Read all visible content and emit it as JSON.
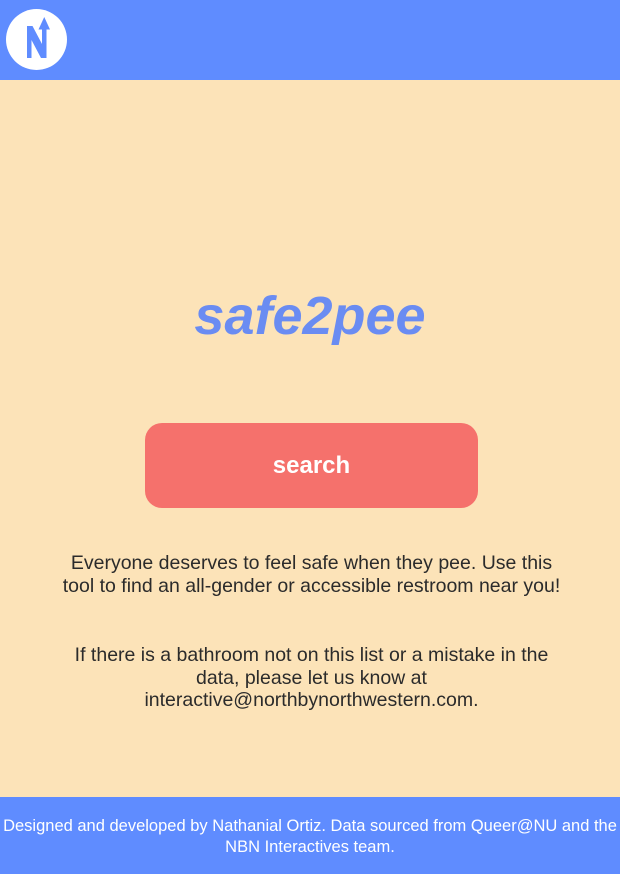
{
  "header": {
    "logo_icon": "nbn-compass-logo-icon",
    "logo_letter": "N",
    "background_color": "#5f8cff"
  },
  "main": {
    "title": "safe2pee",
    "title_color": "#6a8cf2",
    "search_button_label": "search",
    "search_button_color": "#f5716c",
    "description_1": "Everyone deserves to feel safe when they pee. Use this tool to find an all-gender or accessible restroom near you!",
    "description_2": "If there is a bathroom not on this list or a mistake in the data, please let us know at interactive@northbynorthwestern.com.",
    "background_color": "#fce3b8"
  },
  "footer": {
    "credits": "Designed and developed by Nathanial Ortiz. Data sourced from Queer@NU and the NBN Interactives team."
  }
}
